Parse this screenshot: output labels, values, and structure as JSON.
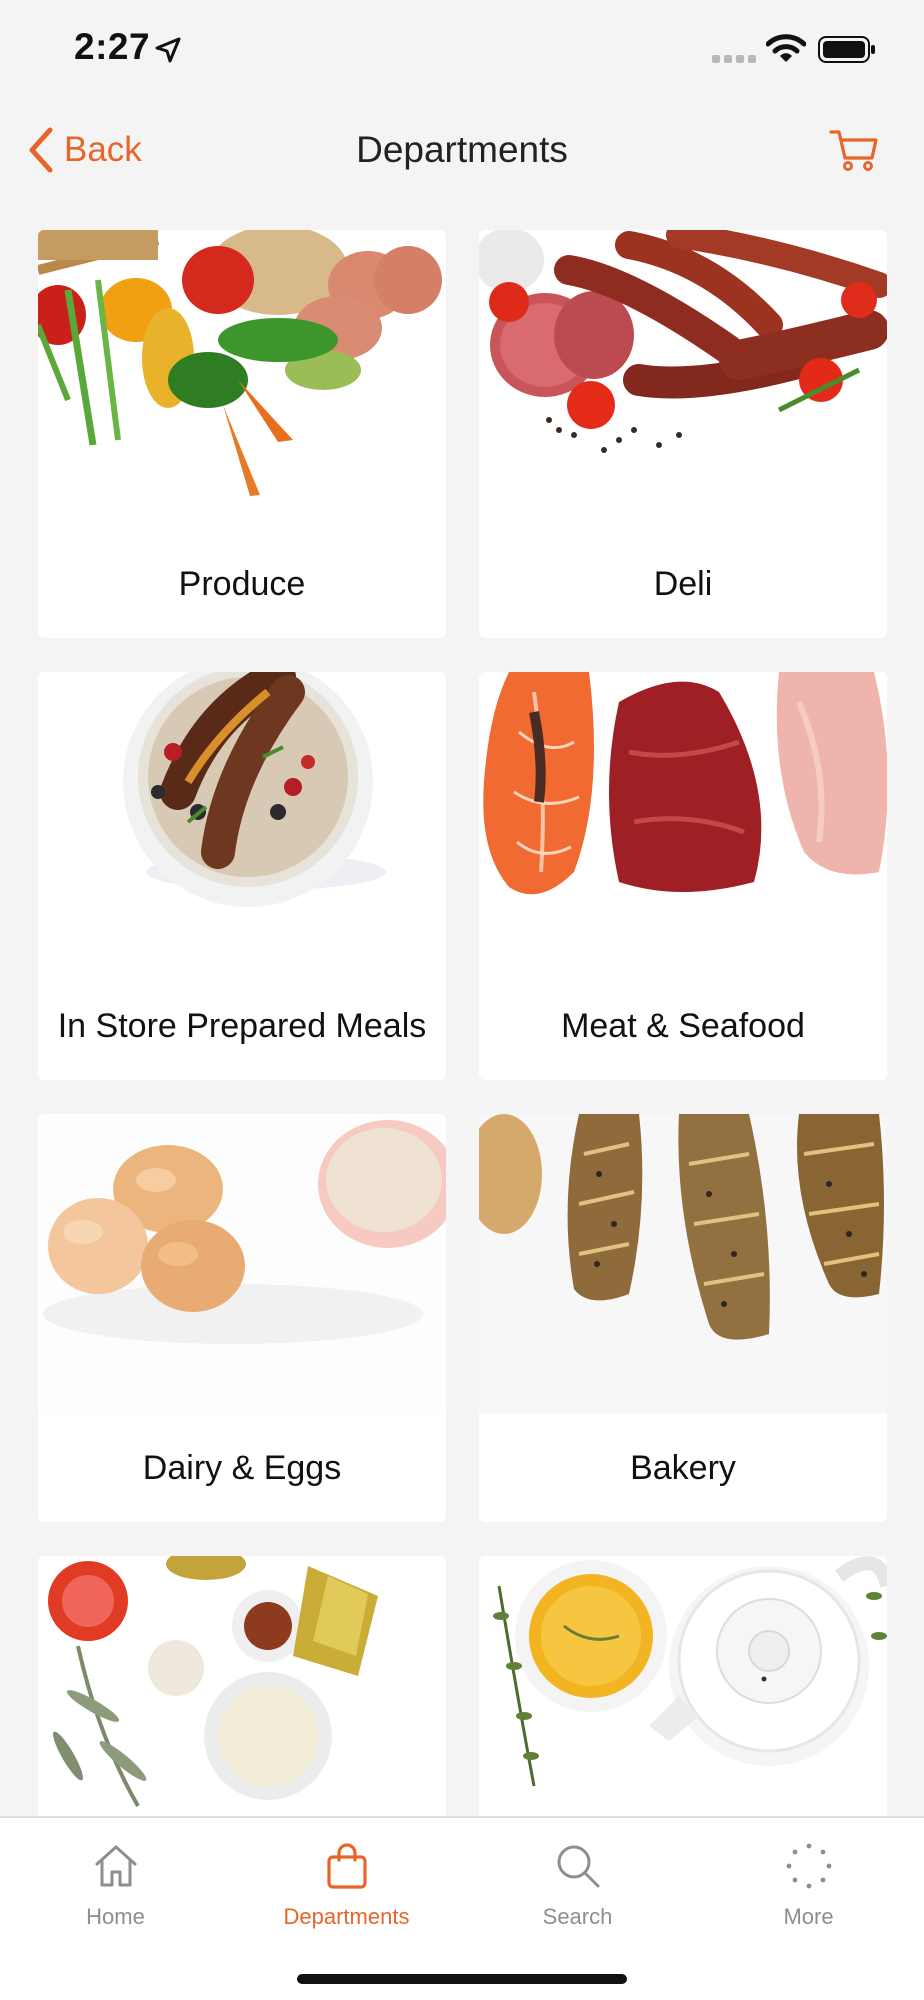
{
  "status_bar": {
    "time": "2:27"
  },
  "nav": {
    "back_label": "Back",
    "title": "Departments",
    "accent": "#e8652a"
  },
  "departments": [
    {
      "label": "Produce",
      "icon": "vegetables-image"
    },
    {
      "label": "Deli",
      "icon": "sausages-image"
    },
    {
      "label": "In Store Prepared Meals",
      "icon": "porridge-bowl-image"
    },
    {
      "label": "Meat & Seafood",
      "icon": "salmon-beef-chicken-image"
    },
    {
      "label": "Dairy & Eggs",
      "icon": "eggs-milk-image"
    },
    {
      "label": "Bakery",
      "icon": "baguettes-image"
    },
    {
      "label": "",
      "icon": "spices-oil-image"
    },
    {
      "label": "",
      "icon": "tea-pot-image"
    }
  ],
  "tab_bar": {
    "tabs": [
      {
        "label": "Home",
        "icon": "home-icon"
      },
      {
        "label": "Departments",
        "icon": "shopping-bag-icon",
        "active": true
      },
      {
        "label": "Search",
        "icon": "search-icon"
      },
      {
        "label": "More",
        "icon": "more-spinner-icon"
      }
    ]
  }
}
